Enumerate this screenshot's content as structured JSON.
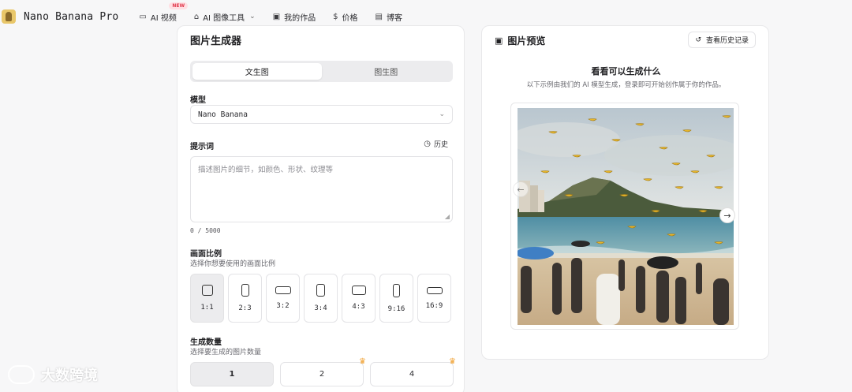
{
  "nav": {
    "brand": "Nano Banana Pro",
    "items": [
      {
        "icon": "video-icon",
        "label": "AI 视频",
        "badge": "NEW"
      },
      {
        "icon": "image-tool-icon",
        "label": "AI 图像工具",
        "dropdown": true
      },
      {
        "icon": "gallery-icon",
        "label": "我的作品"
      },
      {
        "icon": "dollar-icon",
        "label": "价格"
      },
      {
        "icon": "blog-icon",
        "label": "博客"
      }
    ]
  },
  "generator": {
    "title": "图片生成器",
    "tabs": [
      "文生图",
      "图生图"
    ],
    "active_tab": "文生图",
    "model_label": "模型",
    "model_value": "Nano Banana",
    "prompt_label": "提示词",
    "history_label": "历史",
    "prompt_placeholder": "描述图片的细节，如颜色、形状、纹理等",
    "prompt_counter": "0 / 5000",
    "ratio_label": "画面比例",
    "ratio_sub": "选择你想要使用的画面比例",
    "ratios": [
      "1:1",
      "2:3",
      "3:2",
      "3:4",
      "4:3",
      "9:16",
      "16:9"
    ],
    "active_ratio": "1:1",
    "count_label": "生成数量",
    "count_sub": "选择要生成的图片数量",
    "counts": [
      "1",
      "2",
      "4"
    ],
    "active_count": "1"
  },
  "preview": {
    "title": "图片预览",
    "view_history": "查看历史记录",
    "heading": "看看可以生成什么",
    "description": "以下示例由我们的 AI 模型生成，登录即可开始创作属于你的作品。"
  },
  "watermark": "大数跨境",
  "colors": {
    "accent_new_badge": "#e0394c",
    "crown": "#f0a030",
    "active_segment": "#ececee"
  }
}
